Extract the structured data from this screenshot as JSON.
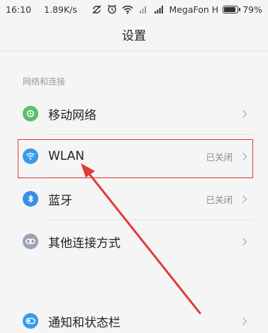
{
  "status_bar": {
    "time": "16:10",
    "speed": "1.89K/s",
    "carrier": "MegaFon H",
    "battery_percent": "79%",
    "battery_level": 0.79,
    "icons": [
      "sync-off-icon",
      "alarm-icon",
      "wifi-icon",
      "signal-off-icon",
      "signal-icon",
      "battery-icon"
    ]
  },
  "title": "设置",
  "section_header": "网络和连接",
  "items": [
    {
      "label": "移动网络",
      "value": "",
      "icon": "mobile-network-icon",
      "color": "#5cbf6a"
    },
    {
      "label": "WLAN",
      "value": "已关闭",
      "icon": "wifi-icon",
      "color": "#3a9be8"
    },
    {
      "label": "蓝牙",
      "value": "已关闭",
      "icon": "bluetooth-icon",
      "color": "#3a8ee6"
    },
    {
      "label": "其他连接方式",
      "value": "",
      "icon": "link-icon",
      "color": "#9aa4b2"
    }
  ],
  "items2": [
    {
      "label": "通知和状态栏",
      "value": "",
      "icon": "notification-icon",
      "color": "#3a9be8"
    }
  ],
  "annotation": {
    "highlight_color": "#e03b3b"
  }
}
